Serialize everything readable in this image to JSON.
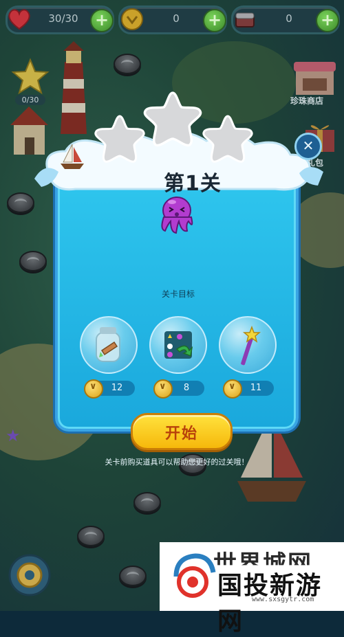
{
  "resources": {
    "lives": {
      "value": "30/30",
      "icon": "heart-icon"
    },
    "coins": {
      "value": "0",
      "icon": "coin-icon"
    },
    "items": {
      "value": "0",
      "icon": "chest-icon"
    }
  },
  "side": {
    "star_progress": "0/30",
    "shop_label": "珍珠商店",
    "gift_label": "超值礼包"
  },
  "dialog": {
    "title": "第1关",
    "goal_label": "关卡目标",
    "boosters": [
      {
        "name": "bottle-booster",
        "price": "12"
      },
      {
        "name": "shuffle-booster",
        "price": "8"
      },
      {
        "name": "wand-booster",
        "price": "11"
      }
    ],
    "start_label": "开始",
    "hint": "关卡前购买道具可以帮助您更好的过关哦！"
  },
  "watermark": {
    "top": "世界城网",
    "main": "国投新游网",
    "url": "www.sxsgytr.com"
  },
  "colors": {
    "dialog_blue": "#2fc6ee",
    "start_yellow": "#ffd31d",
    "start_text": "#b8420a",
    "octopus": "#b23ccf"
  }
}
